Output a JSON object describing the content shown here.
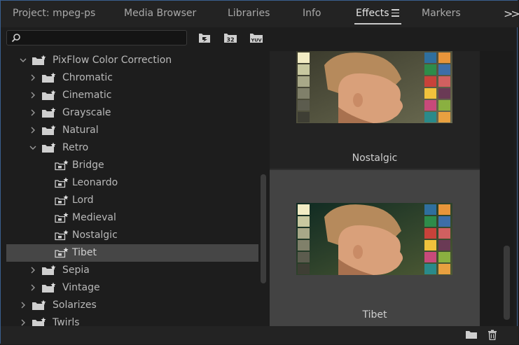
{
  "tabs": [
    {
      "label": "Project: mpeg-ps",
      "active": false
    },
    {
      "label": "Media Browser",
      "active": false
    },
    {
      "label": "Libraries",
      "active": false
    },
    {
      "label": "Info",
      "active": false
    },
    {
      "label": "Effects",
      "active": true
    },
    {
      "label": "Markers",
      "active": false
    }
  ],
  "overflow_icon": ">>",
  "search": {
    "placeholder": "",
    "value": ""
  },
  "toolbar": {
    "accelerated_label": "",
    "bit32_label": "32",
    "yuv_label": "YUV"
  },
  "tree": [
    {
      "label": "PixFlow Color Correction",
      "level": 1,
      "expanded": true,
      "kind": "bin"
    },
    {
      "label": "Chromatic",
      "level": 2,
      "expanded": false,
      "kind": "bin"
    },
    {
      "label": "Cinematic",
      "level": 2,
      "expanded": false,
      "kind": "bin"
    },
    {
      "label": "Grayscale",
      "level": 2,
      "expanded": false,
      "kind": "bin"
    },
    {
      "label": "Natural",
      "level": 2,
      "expanded": false,
      "kind": "bin"
    },
    {
      "label": "Retro",
      "level": 2,
      "expanded": true,
      "kind": "bin"
    },
    {
      "label": "Bridge",
      "level": 3,
      "kind": "preset"
    },
    {
      "label": "Leonardo",
      "level": 3,
      "kind": "preset"
    },
    {
      "label": "Lord",
      "level": 3,
      "kind": "preset"
    },
    {
      "label": "Medieval",
      "level": 3,
      "kind": "preset"
    },
    {
      "label": "Nostalgic",
      "level": 3,
      "kind": "preset"
    },
    {
      "label": "Tibet",
      "level": 3,
      "kind": "preset",
      "selected": true
    },
    {
      "label": "Sepia",
      "level": 2,
      "expanded": false,
      "kind": "bin"
    },
    {
      "label": "Vintage",
      "level": 2,
      "expanded": false,
      "kind": "bin"
    },
    {
      "label": "Solarizes",
      "level": 1,
      "expanded": false,
      "kind": "bin"
    },
    {
      "label": "Twirls",
      "level": 1,
      "expanded": false,
      "kind": "bin"
    }
  ],
  "previews": [
    {
      "label": "Nostalgic",
      "selected": false
    },
    {
      "label": "Tibet",
      "selected": true
    }
  ],
  "colors": {
    "accent_border": "#3a5f8f",
    "selected_row": "#464646",
    "panel_bg": "#1d1d1d"
  },
  "bottom_icons": [
    "new-folder-icon",
    "trash-icon"
  ]
}
